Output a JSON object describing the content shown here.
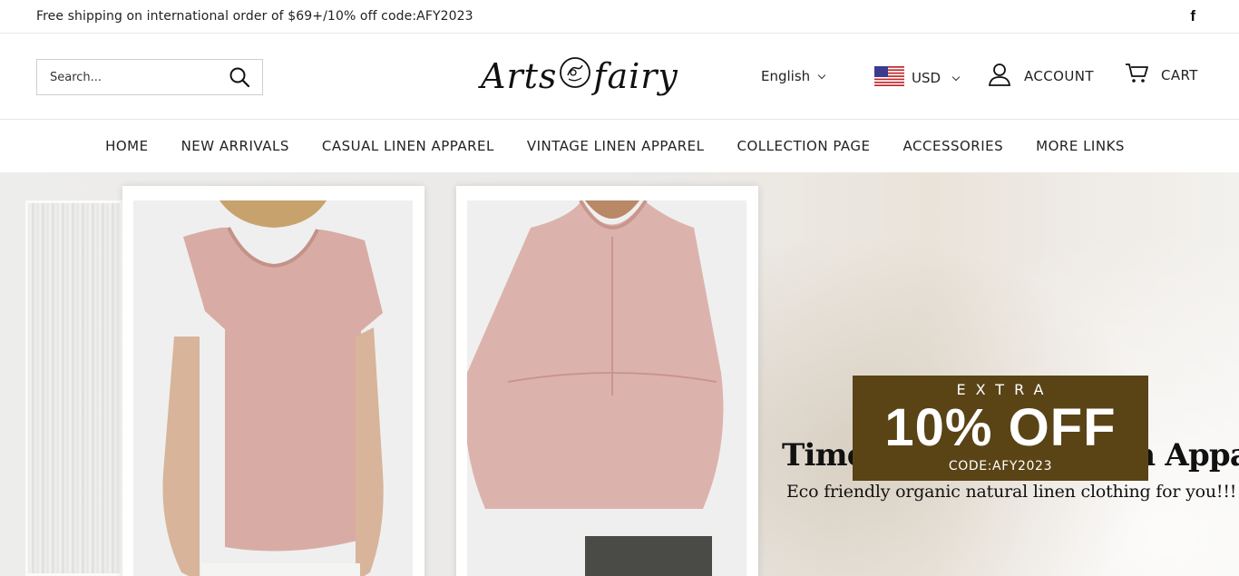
{
  "announcement": {
    "text": "Free shipping on international order of $69+/10% off code:AFY2023",
    "social_icon": "facebook-icon"
  },
  "header": {
    "search": {
      "placeholder": "Search...",
      "icon": "search-icon"
    },
    "logo": {
      "text_left": "Arts",
      "text_right": "fairy"
    },
    "language": {
      "selected": "English"
    },
    "currency": {
      "selected": "USD",
      "flag": "us-flag-icon"
    },
    "account": {
      "label": "ACCOUNT",
      "icon": "user-icon"
    },
    "cart": {
      "label": "CART",
      "icon": "cart-icon"
    }
  },
  "nav": {
    "items": [
      {
        "label": "HOME"
      },
      {
        "label": "NEW ARRIVALS"
      },
      {
        "label": "CASUAL LINEN APPAREL"
      },
      {
        "label": "VINTAGE LINEN APPAREL"
      },
      {
        "label": "COLLECTION PAGE"
      },
      {
        "label": "ACCESSORIES"
      },
      {
        "label": "MORE LINKS"
      }
    ]
  },
  "hero": {
    "headline": "Timeless Casual Linen Apparel",
    "subline": "Eco friendly organic natural linen clothing for you!!!",
    "promo": {
      "extra": "EXTRA",
      "discount": "10% OFF",
      "code": "CODE:AFY2023",
      "background": "#5a4416"
    },
    "product_color": "#d9aca4"
  }
}
